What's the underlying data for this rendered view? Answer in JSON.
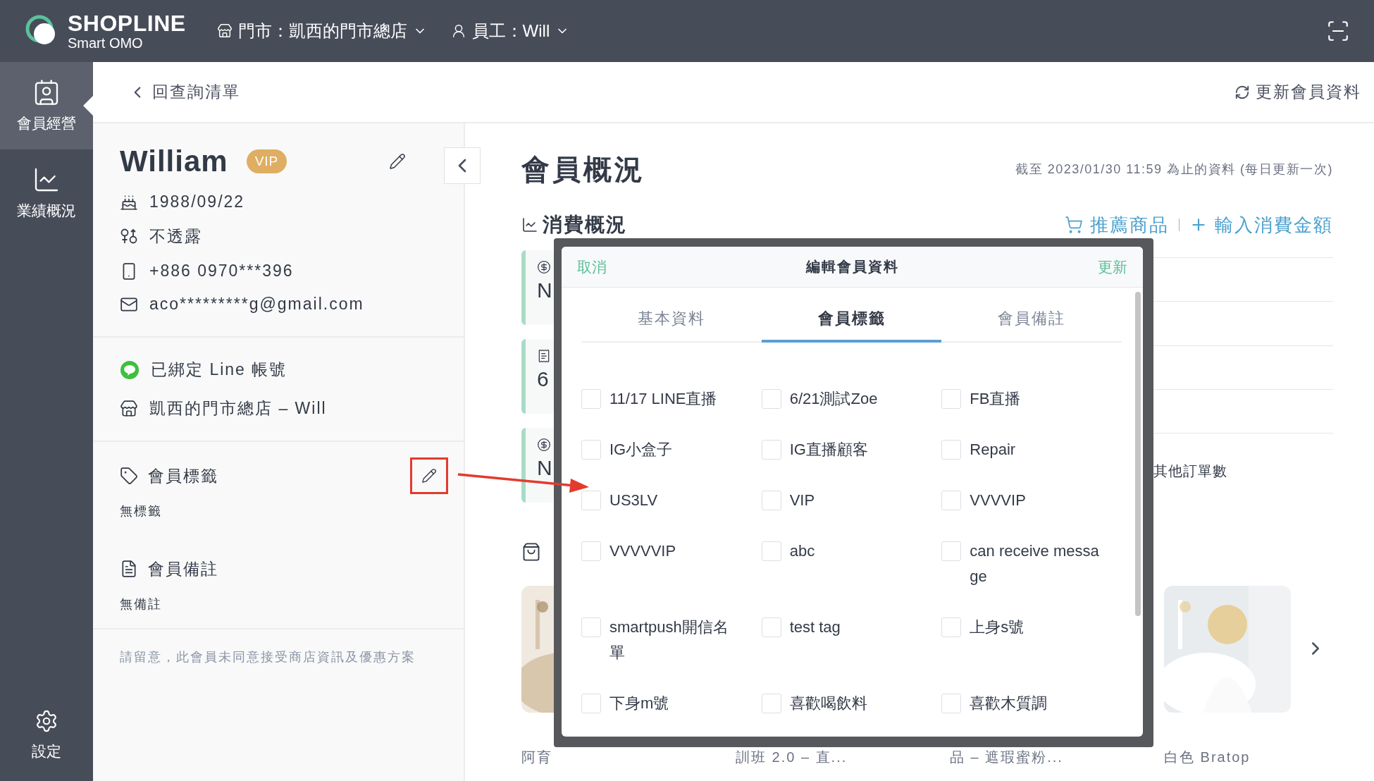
{
  "top_bar": {
    "brand": "SHOPLINE",
    "brand_sub": "Smart OMO",
    "store_selector": "門市：凱西的門市總店",
    "staff_selector": "員工：Will"
  },
  "nav": {
    "items": [
      {
        "kind": "members",
        "label": "會員經營",
        "selected": true
      },
      {
        "kind": "performance",
        "label": "業績概況",
        "selected": false
      }
    ],
    "footer_item": {
      "label": "設定"
    }
  },
  "sub_header": {
    "back_link": "回查詢清單",
    "refresh_button": "更新會員資料"
  },
  "member": {
    "name": "William",
    "badge": "VIP",
    "details": [
      {
        "kind": "birthday",
        "text": "1988/09/22"
      },
      {
        "kind": "gender",
        "text": "不透露"
      },
      {
        "kind": "phone",
        "text": "+886 0970***396"
      },
      {
        "kind": "email",
        "text": "aco*********g@gmail.com"
      }
    ],
    "links": [
      {
        "kind": "line",
        "text": "已綁定 Line 帳號"
      },
      {
        "kind": "store",
        "text": "凱西的門市總店 – Will"
      }
    ],
    "sections": [
      {
        "kind": "tags",
        "title": "會員標籤",
        "value": "無標籤",
        "editable": true,
        "highlighted": true
      },
      {
        "kind": "notes",
        "title": "會員備註",
        "value": "無備註",
        "editable": false,
        "highlighted": false
      }
    ],
    "notice": "請留意，此會員未同意接受商店資訊及優惠方案"
  },
  "overview": {
    "title": "會員概況",
    "timestamp": "截至 2023/01/30 11:59 為止的資料 (每日更新一次)",
    "spending": {
      "title": "消費概況",
      "actions": [
        {
          "kind": "recommend",
          "label": "推薦商品"
        },
        {
          "kind": "add",
          "label": "輸入消費金額"
        }
      ],
      "stat_cards": [
        {
          "kind": "money",
          "value": "N"
        },
        {
          "kind": "orders",
          "value": "6"
        },
        {
          "kind": "money",
          "value": "N"
        }
      ],
      "other_orders_label": "其他訂單數"
    },
    "products": [
      {
        "kind": "picture",
        "caption": "阿育"
      },
      {
        "caption": "訓班 2.0 – 直..."
      },
      {
        "caption": "品 – 遮瑕蜜粉..."
      },
      {
        "kind": "picture",
        "caption": "白色 Bratop"
      }
    ]
  },
  "dialog": {
    "title": "編輯會員資料",
    "cancel": "取消",
    "confirm": "更新",
    "tabs": [
      {
        "label": "基本資料",
        "selected": false
      },
      {
        "label": "會員標籤",
        "selected": true
      },
      {
        "label": "會員備註",
        "selected": false
      }
    ],
    "tags": [
      {
        "label": "11/17 LINE直播",
        "checked": false
      },
      {
        "label": "6/21測試Zoe",
        "checked": false
      },
      {
        "label": "FB直播",
        "checked": false
      },
      {
        "label": "IG小盒子",
        "checked": false
      },
      {
        "label": "IG直播顧客",
        "checked": false
      },
      {
        "label": "Repair",
        "checked": false
      },
      {
        "label": "US3LV",
        "checked": false
      },
      {
        "label": "VIP",
        "checked": false
      },
      {
        "label": "VVVVIP",
        "checked": false
      },
      {
        "label": "VVVVVIP",
        "checked": false
      },
      {
        "label": "abc",
        "checked": false
      },
      {
        "label": "can receive message",
        "checked": false
      },
      {
        "label": "smartpush開信名單",
        "checked": false
      },
      {
        "label": "test tag",
        "checked": false
      },
      {
        "label": "上身s號",
        "checked": false
      },
      {
        "label": "下身m號",
        "checked": false
      },
      {
        "label": "喜歡喝飲料",
        "checked": false
      },
      {
        "label": "喜歡木質調",
        "checked": false
      }
    ]
  }
}
